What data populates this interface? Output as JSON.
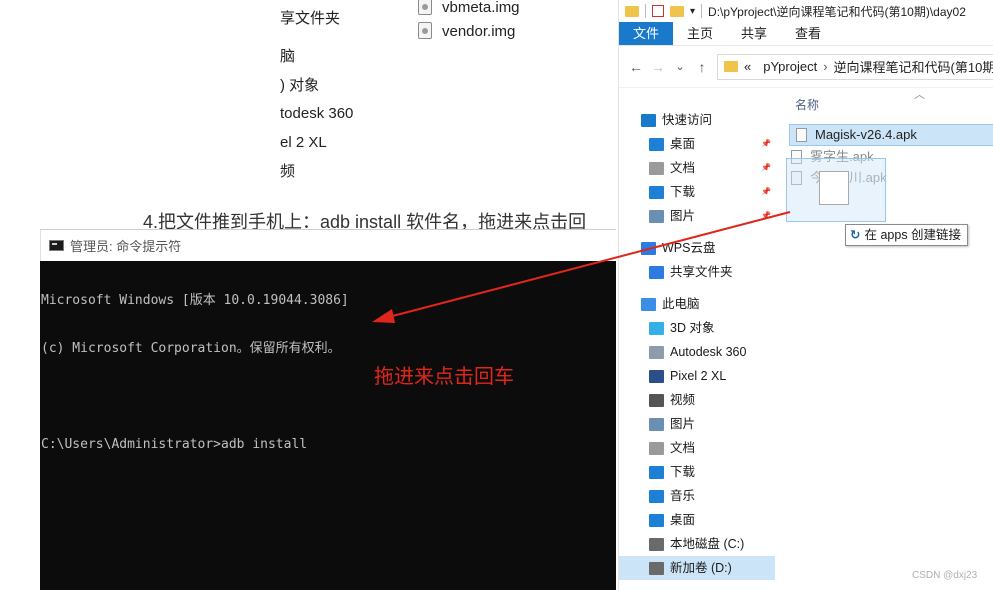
{
  "background": {
    "nav_items": [
      "享文件夹",
      "脑",
      ") 对象",
      "todesk 360",
      "el 2 XL",
      "频"
    ],
    "files": [
      "vbmeta.img",
      "vendor.img"
    ]
  },
  "step_text": "4.把文件推到手机上：adb install 软件名，拖进来点击回",
  "cmd": {
    "title": "管理员: 命令提示符",
    "lines": [
      "Microsoft Windows [版本 10.0.19044.3086]",
      "(c) Microsoft Corporation。保留所有权利。",
      "",
      "C:\\Users\\Administrator>adb install"
    ],
    "annotation": "拖进来点击回车"
  },
  "explorer": {
    "titlebar_path": "D:\\pYproject\\逆向课程笔记和代码(第10期)\\day02",
    "ribbon_tabs": [
      "文件",
      "主页",
      "共享",
      "查看"
    ],
    "nav_buttons": [
      "←",
      "→",
      "⌄",
      "↑"
    ],
    "address": {
      "chevron": "«",
      "segments": [
        "pYproject",
        "逆向课程笔记和代码(第10期"
      ]
    },
    "nav": [
      {
        "label": "快速访问",
        "icon": "star-icon",
        "color": "#1979ca"
      },
      {
        "label": "桌面",
        "icon": "desktop-icon",
        "color": "#1e7fd6"
      },
      {
        "label": "文档",
        "icon": "document-icon",
        "color": "#9a9a9a"
      },
      {
        "label": "下载",
        "icon": "download-icon",
        "color": "#1e7fd6"
      },
      {
        "label": "图片",
        "icon": "pictures-icon",
        "color": "#6a8fb3"
      },
      {
        "label": "WPS云盘",
        "icon": "cloud-icon",
        "color": "#2b7be0"
      },
      {
        "label": "共享文件夹",
        "icon": "share-icon",
        "color": "#2b7be0"
      },
      {
        "label": "此电脑",
        "icon": "computer-icon",
        "color": "#3a8ee6"
      },
      {
        "label": "3D 对象",
        "icon": "cube-icon",
        "color": "#35b0e6"
      },
      {
        "label": "Autodesk 360",
        "icon": "autodesk-icon",
        "color": "#8c9cab"
      },
      {
        "label": "Pixel 2 XL",
        "icon": "phone-icon",
        "color": "#2c4f8a"
      },
      {
        "label": "视频",
        "icon": "video-icon",
        "color": "#555555"
      },
      {
        "label": "图片",
        "icon": "pictures-icon",
        "color": "#6a8fb3"
      },
      {
        "label": "文档",
        "icon": "document-icon",
        "color": "#9a9a9a"
      },
      {
        "label": "下载",
        "icon": "download-icon",
        "color": "#1e7fd6"
      },
      {
        "label": "音乐",
        "icon": "music-icon",
        "color": "#1e7fd6"
      },
      {
        "label": "桌面",
        "icon": "desktop-icon",
        "color": "#1e7fd6"
      },
      {
        "label": "本地磁盘 (C:)",
        "icon": "drive-c-icon",
        "color": "#6a6a6a"
      },
      {
        "label": "新加卷 (D:)",
        "icon": "drive-d-icon",
        "color": "#6a6a6a"
      }
    ],
    "column_header": "名称",
    "files": [
      "Magisk-v26.4.apk",
      "雾字生.apk",
      "今日间川.apk"
    ],
    "drop_tip": {
      "link_glyph": "↻",
      "text": "在 apps 创建链接"
    }
  },
  "watermark": "CSDN @dxj23"
}
